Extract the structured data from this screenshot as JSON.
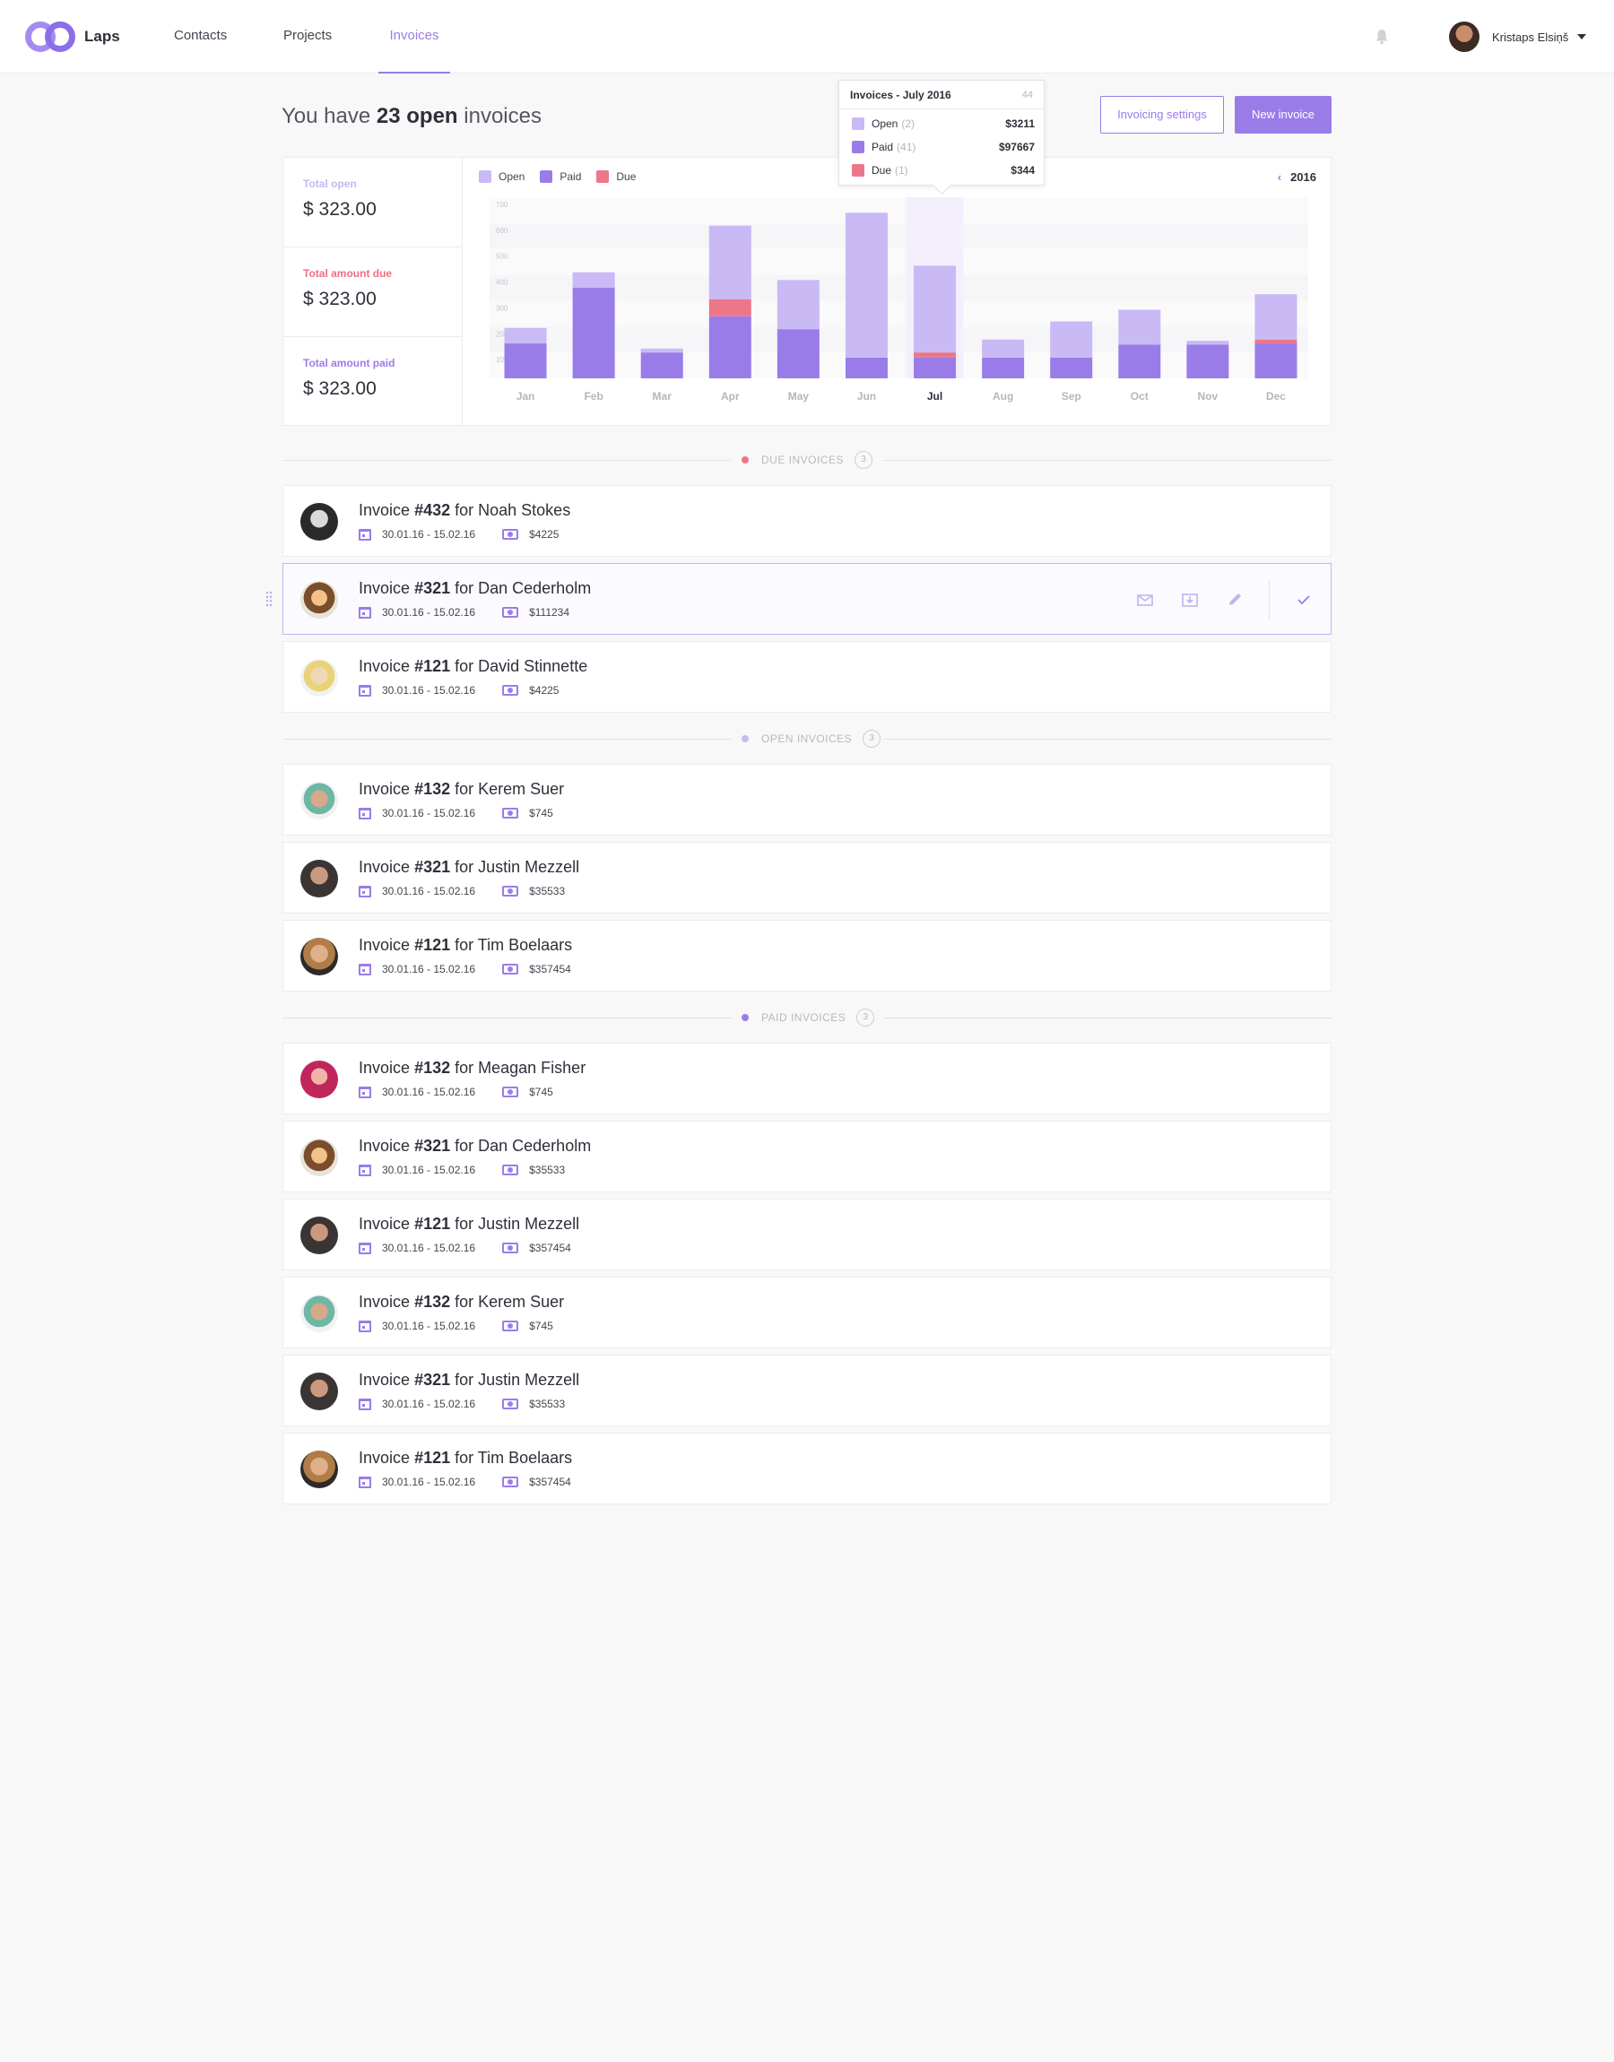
{
  "app": {
    "name": "Laps"
  },
  "nav": [
    {
      "label": "Contacts",
      "active": false
    },
    {
      "label": "Projects",
      "active": false
    },
    {
      "label": "Invoices",
      "active": true
    }
  ],
  "user": {
    "name": "Kristaps Elsiņš"
  },
  "page": {
    "title_prefix": "You have",
    "title_count": "23 open",
    "title_suffix": "invoices",
    "btn_settings": "Invoicing settings",
    "btn_new": "New invoice"
  },
  "totals": {
    "open": {
      "label": "Total open",
      "value": "$ 323.00"
    },
    "due": {
      "label": "Total amount due",
      "value": "$ 323.00"
    },
    "paid": {
      "label": "Total amount paid",
      "value": "$ 323.00"
    }
  },
  "colors": {
    "open": "#c9b9f4",
    "paid": "#9a7ce9",
    "due": "#ec7789",
    "accent": "#9a7ce9"
  },
  "chart_data": {
    "type": "bar",
    "stacked": true,
    "year": "2016",
    "categories": [
      "Jan",
      "Feb",
      "Mar",
      "Apr",
      "May",
      "Jun",
      "Jul",
      "Aug",
      "Sep",
      "Oct",
      "Nov",
      "Dec"
    ],
    "selected": "Jul",
    "ylim": [
      0,
      700
    ],
    "yticks": [
      100,
      200,
      300,
      400,
      500,
      600,
      700
    ],
    "grid": true,
    "legend": "top-left",
    "series": [
      {
        "name": "Paid",
        "color": "#9a7ce9",
        "values": [
          135,
          350,
          100,
          240,
          190,
          80,
          80,
          80,
          80,
          130,
          130,
          135
        ]
      },
      {
        "name": "Due",
        "color": "#ec7789",
        "values": [
          0,
          0,
          0,
          65,
          0,
          0,
          20,
          0,
          0,
          0,
          0,
          15
        ]
      },
      {
        "name": "Open",
        "color": "#c9b9f4",
        "values": [
          60,
          60,
          15,
          285,
          190,
          560,
          335,
          70,
          140,
          135,
          15,
          175
        ]
      }
    ]
  },
  "tooltip": {
    "title": "Invoices - July 2016",
    "count": "44",
    "rows": [
      {
        "label": "Open",
        "n": "(2)",
        "amount": "$3211"
      },
      {
        "label": "Paid",
        "n": "(41)",
        "amount": "$97667"
      },
      {
        "label": "Due",
        "n": "(1)",
        "amount": "$344"
      }
    ]
  },
  "sections": {
    "due": {
      "label": "DUE INVOICES",
      "count": "3"
    },
    "open": {
      "label": "OPEN INVOICES",
      "count": "3"
    },
    "paid": {
      "label": "PAID INVOICES",
      "count": "3"
    }
  },
  "due_invoices": [
    {
      "prefix": "Invoice",
      "number": "#432",
      "client": "for Noah Stokes",
      "dates": "30.01.16 - 15.02.16",
      "amount": "$4225"
    },
    {
      "prefix": "Invoice",
      "number": "#321",
      "client": "for Dan Cederholm",
      "dates": "30.01.16 - 15.02.16",
      "amount": "$111234"
    },
    {
      "prefix": "Invoice",
      "number": "#121",
      "client": "for David Stinnette",
      "dates": "30.01.16 - 15.02.16",
      "amount": "$4225"
    }
  ],
  "open_invoices": [
    {
      "prefix": "Invoice",
      "number": "#132",
      "client": "for Kerem Suer",
      "dates": "30.01.16 - 15.02.16",
      "amount": "$745"
    },
    {
      "prefix": "Invoice",
      "number": "#321",
      "client": "for Justin Mezzell",
      "dates": "30.01.16 - 15.02.16",
      "amount": "$35533"
    },
    {
      "prefix": "Invoice",
      "number": "#121",
      "client": "for Tim Boelaars",
      "dates": "30.01.16 - 15.02.16",
      "amount": "$357454"
    }
  ],
  "paid_invoices": [
    {
      "prefix": "Invoice",
      "number": "#132",
      "client": "for Meagan Fisher",
      "dates": "30.01.16 - 15.02.16",
      "amount": "$745"
    },
    {
      "prefix": "Invoice",
      "number": "#321",
      "client": "for Dan Cederholm",
      "dates": "30.01.16 - 15.02.16",
      "amount": "$35533"
    },
    {
      "prefix": "Invoice",
      "number": "#121",
      "client": "for Justin Mezzell",
      "dates": "30.01.16 - 15.02.16",
      "amount": "$357454"
    },
    {
      "prefix": "Invoice",
      "number": "#132",
      "client": "for Kerem Suer",
      "dates": "30.01.16 - 15.02.16",
      "amount": "$745"
    },
    {
      "prefix": "Invoice",
      "number": "#321",
      "client": "for Justin Mezzell",
      "dates": "30.01.16 - 15.02.16",
      "amount": "$35533"
    },
    {
      "prefix": "Invoice",
      "number": "#121",
      "client": "for Tim Boelaars",
      "dates": "30.01.16 - 15.02.16",
      "amount": "$357454"
    }
  ]
}
